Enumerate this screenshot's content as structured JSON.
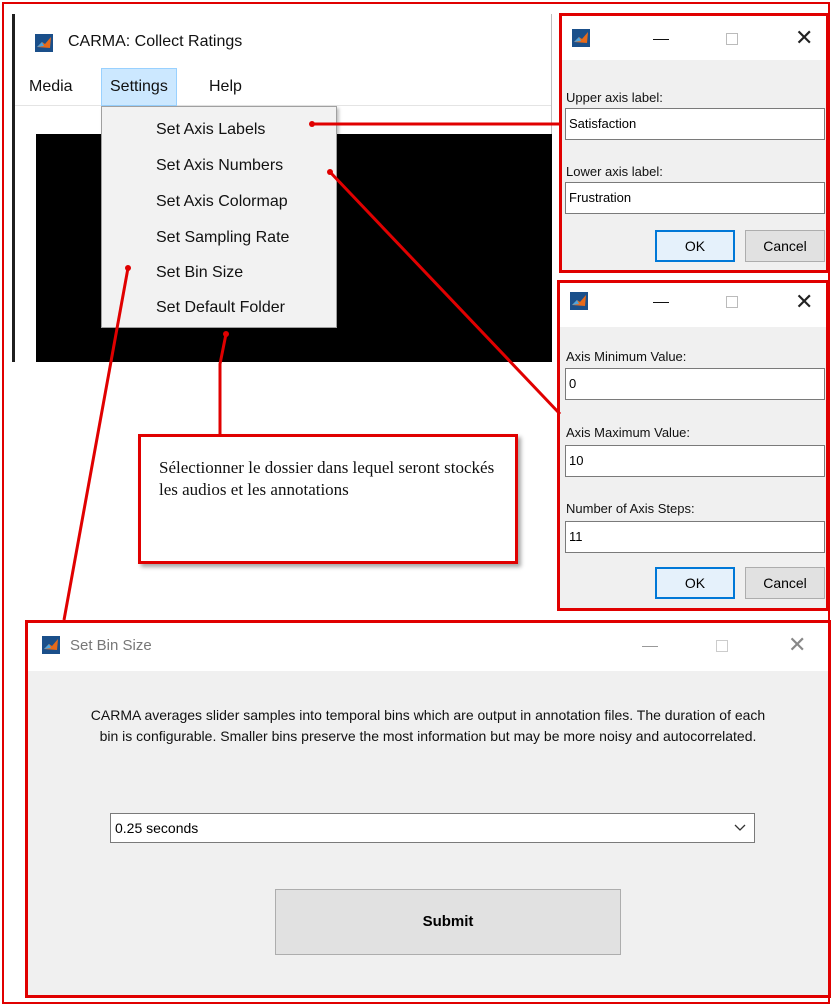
{
  "main_window": {
    "title": "CARMA: Collect Ratings",
    "menus": [
      "Media",
      "Settings",
      "Help"
    ],
    "settings_menu_items": [
      "Set Axis Labels",
      "Set Axis Numbers",
      "Set Axis Colormap",
      "Set Sampling Rate",
      "Set Bin Size",
      "Set Default Folder"
    ]
  },
  "axis_labels_dialog": {
    "upper_label": "Upper axis label:",
    "upper_value": "Satisfaction",
    "lower_label": "Lower axis label:",
    "lower_value": "Frustration",
    "ok": "OK",
    "cancel": "Cancel"
  },
  "axis_numbers_dialog": {
    "min_label": "Axis Minimum Value:",
    "min_value": "0",
    "max_label": "Axis Maximum Value:",
    "max_value": "10",
    "steps_label": "Number of Axis Steps:",
    "steps_value": "11",
    "ok": "OK",
    "cancel": "Cancel"
  },
  "callout": {
    "text": "Sélectionner le dossier dans lequel seront stockés les audios et les annotations"
  },
  "bin_dialog": {
    "title": "Set Bin Size",
    "description": "CARMA averages slider samples into temporal bins which are output in annotation files. The duration of each bin is configurable. Smaller bins preserve the most information but may be more noisy and autocorrelated.",
    "selected": "0.25 seconds",
    "submit": "Submit"
  },
  "colors": {
    "annotation": "#e00000",
    "menu_highlight": "#cce8ff",
    "default_button": "#0078d7"
  },
  "icons": {
    "app": "matlab-icon",
    "minimize": "minimize-icon",
    "maximize": "maximize-icon",
    "close": "close-icon",
    "dropdown": "chevron-down-icon"
  }
}
